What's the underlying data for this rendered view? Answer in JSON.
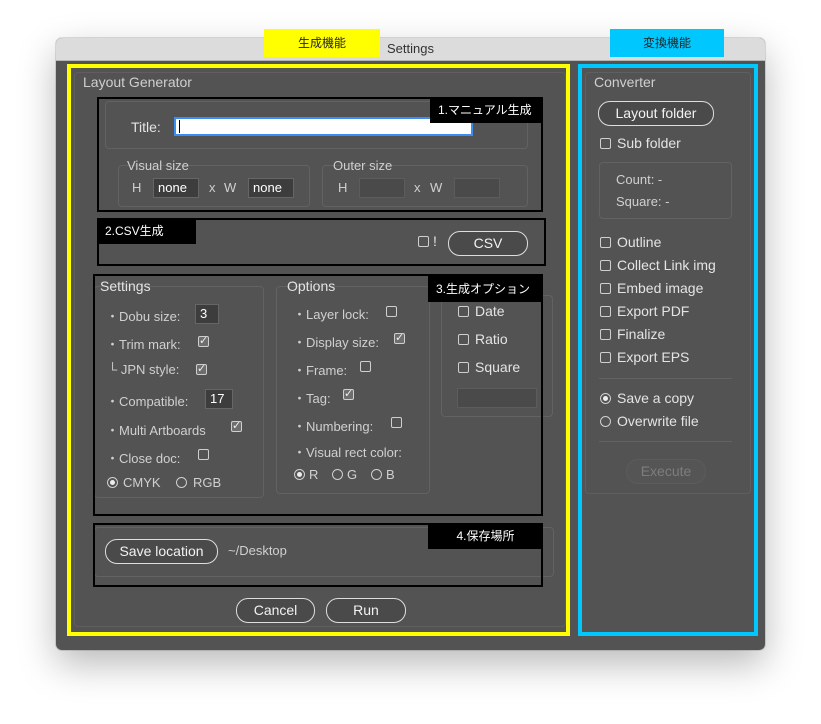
{
  "window": {
    "title": "Settings"
  },
  "callouts": {
    "generate": "生成機能",
    "convert": "変換機能",
    "manual": "1.マニュアル生成",
    "csv_gen": "2.CSV生成",
    "options_gen": "3.生成オプション",
    "save_place": "4.保存場所"
  },
  "generator": {
    "heading": "Layout Generator",
    "title_label": "Title:",
    "title_value": "",
    "visual_size": {
      "label": "Visual size",
      "h_label": "H",
      "x_label": "x",
      "w_label": "W",
      "h_value": "none",
      "w_value": "none"
    },
    "outer_size": {
      "label": "Outer size",
      "h_label": "H",
      "x_label": "x",
      "w_label": "W",
      "h_value": "",
      "w_value": ""
    },
    "csv": {
      "excl_label": "!",
      "button": "CSV"
    },
    "settings": {
      "heading": "Settings",
      "dobu_label": "・Dobu size:",
      "dobu_value": "3",
      "trim_label": "・Trim mark:",
      "jpn_label": "└ JPN style:",
      "compat_label": "・Compatible:",
      "compat_value": "17",
      "multi_label": "・Multi Artboards",
      "close_label": "・Close doc:",
      "cmyk": "CMYK",
      "rgb": "RGB"
    },
    "options": {
      "heading": "Options",
      "layer_lock": "・Layer lock:",
      "display_size": "・Display size:",
      "frame": "・Frame:",
      "tag": "・Tag:",
      "numbering": "・Numbering:",
      "rect_color": "・Visual rect color:",
      "r": "R",
      "g": "G",
      "b": "B"
    },
    "extra": {
      "date": "Date",
      "ratio": "Ratio",
      "square": "Square",
      "field_value": ""
    },
    "save": {
      "button": "Save location",
      "path": "~/Desktop"
    },
    "cancel": "Cancel",
    "run": "Run"
  },
  "converter": {
    "heading": "Converter",
    "layout_folder": "Layout folder",
    "sub_folder": "Sub folder",
    "count": "Count: -",
    "square": "Square: -",
    "outline": "Outline",
    "collect": "Collect Link img",
    "embed": "Embed image",
    "export_pdf": "Export PDF",
    "finalize": "Finalize",
    "export_eps": "Export EPS",
    "save_copy": "Save a copy",
    "overwrite": "Overwrite file",
    "execute": "Execute"
  },
  "colors": {
    "highlight_yellow": "#ffff00",
    "highlight_cyan": "#00c8ff",
    "panel_bg": "#535353",
    "focus_blue": "#3b8df1"
  }
}
